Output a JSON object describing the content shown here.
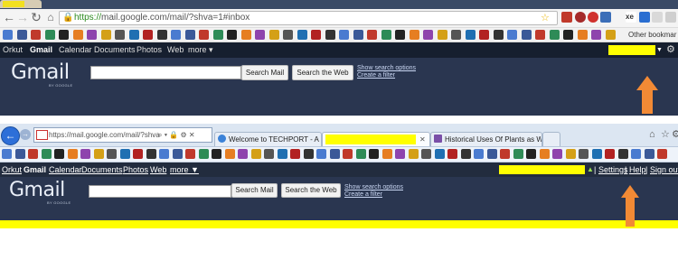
{
  "chrome": {
    "url_scheme": "https://",
    "url_rest": "mail.google.com/mail/?shva=1#inbox",
    "other_bookmarks": "Other bookmar",
    "nav_icons": {
      "back": "back-arrow-icon",
      "forward": "forward-arrow-icon",
      "reload": "reload-icon",
      "home": "home-icon"
    },
    "gbar": {
      "links": [
        "Orkut",
        "Gmail",
        "Calendar",
        "Documents",
        "Photos",
        "Web",
        "more ▾"
      ]
    },
    "search": {
      "search_mail": "Search Mail",
      "search_web": "Search the Web",
      "show_options": "Show search options",
      "create_filter": "Create a filter"
    }
  },
  "gmail_logo": {
    "word": "Gmail",
    "sub": "BY GOOGLE"
  },
  "ie": {
    "address": "https://mail.google.com/mail/?shva",
    "address_icons": "⌕ ▾ 🔒 ⚙ ✕",
    "tabs": [
      {
        "label": "Welcome to TECHPORT - A De..."
      },
      {
        "label": ""
      },
      {
        "label": "Historical Uses Of Plants as We..."
      }
    ],
    "gbar": {
      "links": [
        "Orkut",
        "Gmail",
        "Calendar",
        "Documents",
        "Photos",
        "Web",
        "more ▼"
      ],
      "right_links": [
        "Settings",
        "Help",
        "Sign out"
      ],
      "separator": "|"
    },
    "search": {
      "search_mail": "Search Mail",
      "search_web": "Search the Web",
      "show_options": "Show search options",
      "create_filter": "Create a filter"
    }
  },
  "colors": {
    "arrow": "#f28a35",
    "highlight": "#ffff00",
    "gmail_header": "#2a3650"
  }
}
